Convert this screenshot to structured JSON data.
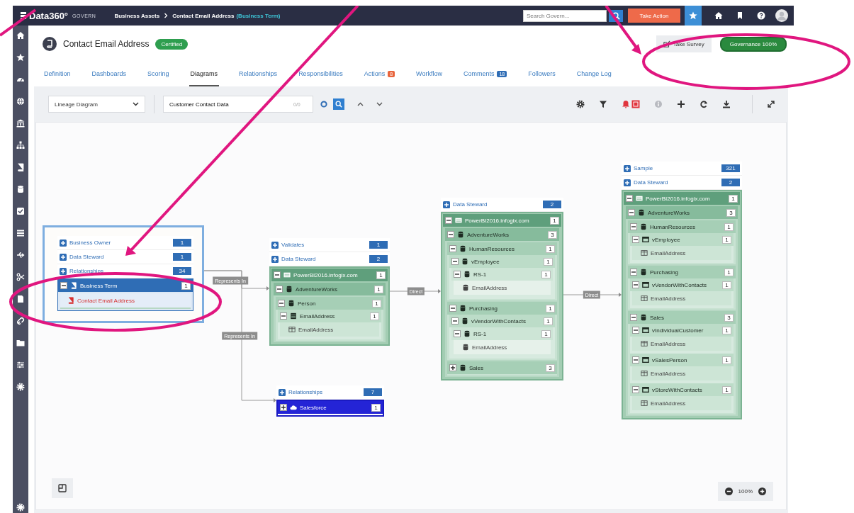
{
  "topbar": {
    "logo": "Data360°",
    "product": "GOVERN",
    "breadcrumb": [
      {
        "label": "Business Assets"
      },
      {
        "label": "Contact Email Address",
        "suffix": "(Business Term)"
      }
    ],
    "search": {
      "placeholder": "Search Govern..."
    },
    "action_button": "Take Action"
  },
  "header": {
    "title": "Contact Email Address",
    "status": "Certified",
    "survey_button": "Take Survey",
    "governance": "Governance 100%"
  },
  "tabs": [
    {
      "label": "Definition",
      "selected": false
    },
    {
      "label": "Dashboards",
      "selected": false
    },
    {
      "label": "Scoring",
      "selected": false
    },
    {
      "label": "Diagrams",
      "selected": true
    },
    {
      "label": "Relationships",
      "selected": false
    },
    {
      "label": "Responsibilities",
      "selected": false
    },
    {
      "label": "Actions",
      "selected": false,
      "badge": {
        "text": "8",
        "color": "#e8643c"
      }
    },
    {
      "label": "Workflow",
      "selected": false
    },
    {
      "label": "Comments",
      "selected": false,
      "badge": {
        "text": "18",
        "color": "#2f6db5"
      }
    },
    {
      "label": "Followers",
      "selected": false
    },
    {
      "label": "Change Log",
      "selected": false
    }
  ],
  "toolbar": {
    "diagram_type": "Lineage Diagram",
    "search_value": "Customer Contact Data",
    "match_count": "0/0"
  },
  "nodes": [
    {
      "selected": true,
      "links": [
        {
          "label": "Business Owner",
          "count": "1"
        },
        {
          "label": "Data Steward",
          "count": "1"
        },
        {
          "label": "Relationships",
          "count": "34"
        }
      ],
      "tree": [
        {
          "kind": "term",
          "label": "Business Term",
          "count": "1",
          "expanded": true,
          "children": [
            {
              "kind": "term-item",
              "label": "Contact Email Address"
            }
          ]
        }
      ]
    },
    {
      "selected": false,
      "links": [
        {
          "label": "Validates",
          "count": "1"
        },
        {
          "label": "Data Steward",
          "count": "2"
        }
      ],
      "tree": [
        {
          "kind": "server",
          "label": "PowerBI2016.infogix.com",
          "count": "1",
          "expanded": true,
          "children": [
            {
              "kind": "database",
              "label": "AdventureWorks",
              "count": "1",
              "expanded": true,
              "children": [
                {
                  "kind": "schema",
                  "label": "Person",
                  "count": "1",
                  "expanded": true,
                  "children": [
                    {
                      "kind": "table",
                      "label": "EmailAddress",
                      "count": "1",
                      "expanded": true,
                      "children": [
                        {
                          "kind": "column",
                          "label": "EmailAddress"
                        }
                      ]
                    }
                  ]
                }
              ]
            }
          ]
        }
      ]
    },
    {
      "selected": false,
      "links": [
        {
          "label": "Relationships",
          "count": "7"
        }
      ],
      "tree": [
        {
          "kind": "system",
          "label": "Salesforce",
          "count": "1",
          "expanded": false
        }
      ]
    },
    {
      "selected": false,
      "links": [
        {
          "label": "Data Steward",
          "count": "2"
        }
      ],
      "tree": [
        {
          "kind": "server",
          "label": "PowerBI2016.infogix.com",
          "count": "1",
          "expanded": true,
          "children": [
            {
              "kind": "database",
              "label": "AdventureWorks",
              "count": "3",
              "expanded": true,
              "children": [
                {
                  "kind": "schema",
                  "label": "HumanResources",
                  "count": "1",
                  "expanded": true,
                  "children": [
                    {
                      "kind": "schema",
                      "label": "vEmployee",
                      "count": "1",
                      "expanded": true,
                      "children": [
                        {
                          "kind": "schema",
                          "label": "RS-1",
                          "count": "1",
                          "expanded": true,
                          "children": [
                            {
                              "kind": "field",
                              "label": "EmailAddress"
                            }
                          ]
                        }
                      ]
                    }
                  ]
                },
                {
                  "kind": "schema",
                  "label": "Purchasing",
                  "count": "1",
                  "expanded": true,
                  "children": [
                    {
                      "kind": "schema",
                      "label": "vVendorWithContacts",
                      "count": "1",
                      "expanded": true,
                      "children": [
                        {
                          "kind": "schema",
                          "label": "RS-1",
                          "count": "1",
                          "expanded": true,
                          "children": [
                            {
                              "kind": "field",
                              "label": "EmailAddress"
                            }
                          ]
                        }
                      ]
                    }
                  ]
                },
                {
                  "kind": "schema",
                  "label": "Sales",
                  "count": "3",
                  "expanded": false
                }
              ]
            }
          ]
        }
      ]
    },
    {
      "selected": false,
      "links": [
        {
          "label": "Sample",
          "count": "321"
        },
        {
          "label": "Data Steward",
          "count": "2"
        }
      ],
      "tree": [
        {
          "kind": "server",
          "label": "PowerBI2016.infogix.com",
          "count": "1",
          "expanded": true,
          "children": [
            {
              "kind": "database",
              "label": "AdventureWorks",
              "count": "3",
              "expanded": true,
              "children": [
                {
                  "kind": "schema",
                  "label": "HumanResources",
                  "count": "1",
                  "expanded": true,
                  "children": [
                    {
                      "kind": "view",
                      "label": "vEmployee",
                      "count": "1",
                      "expanded": true,
                      "children": [
                        {
                          "kind": "column",
                          "label": "EmailAddress"
                        }
                      ]
                    }
                  ]
                },
                {
                  "kind": "schema",
                  "label": "Purchasing",
                  "count": "1",
                  "expanded": true,
                  "children": [
                    {
                      "kind": "view",
                      "label": "vVendorWithContacts",
                      "count": "1",
                      "expanded": true,
                      "children": [
                        {
                          "kind": "column",
                          "label": "EmailAddress"
                        }
                      ]
                    }
                  ]
                },
                {
                  "kind": "schema",
                  "label": "Sales",
                  "count": "3",
                  "expanded": true,
                  "children": [
                    {
                      "kind": "view",
                      "label": "vIndividualCustomer",
                      "count": "1",
                      "expanded": true,
                      "children": [
                        {
                          "kind": "column",
                          "label": "EmailAddress"
                        }
                      ]
                    },
                    {
                      "kind": "view",
                      "label": "vSalesPerson",
                      "count": "1",
                      "expanded": true,
                      "children": [
                        {
                          "kind": "column",
                          "label": "EmailAddress"
                        }
                      ]
                    },
                    {
                      "kind": "view",
                      "label": "vStoreWithContacts",
                      "count": "1",
                      "expanded": true,
                      "children": [
                        {
                          "kind": "column",
                          "label": "EmailAddress"
                        }
                      ]
                    }
                  ]
                }
              ]
            }
          ]
        }
      ]
    }
  ],
  "edges": [
    {
      "label": "Represents In"
    },
    {
      "label": "Represents In"
    },
    {
      "label": "Direct"
    },
    {
      "label": "Direct"
    }
  ],
  "zoom": "100%",
  "annotations": [
    {
      "kind": "line"
    },
    {
      "kind": "arrow"
    },
    {
      "kind": "arrow"
    },
    {
      "kind": "ellipse"
    },
    {
      "kind": "ellipse"
    }
  ]
}
